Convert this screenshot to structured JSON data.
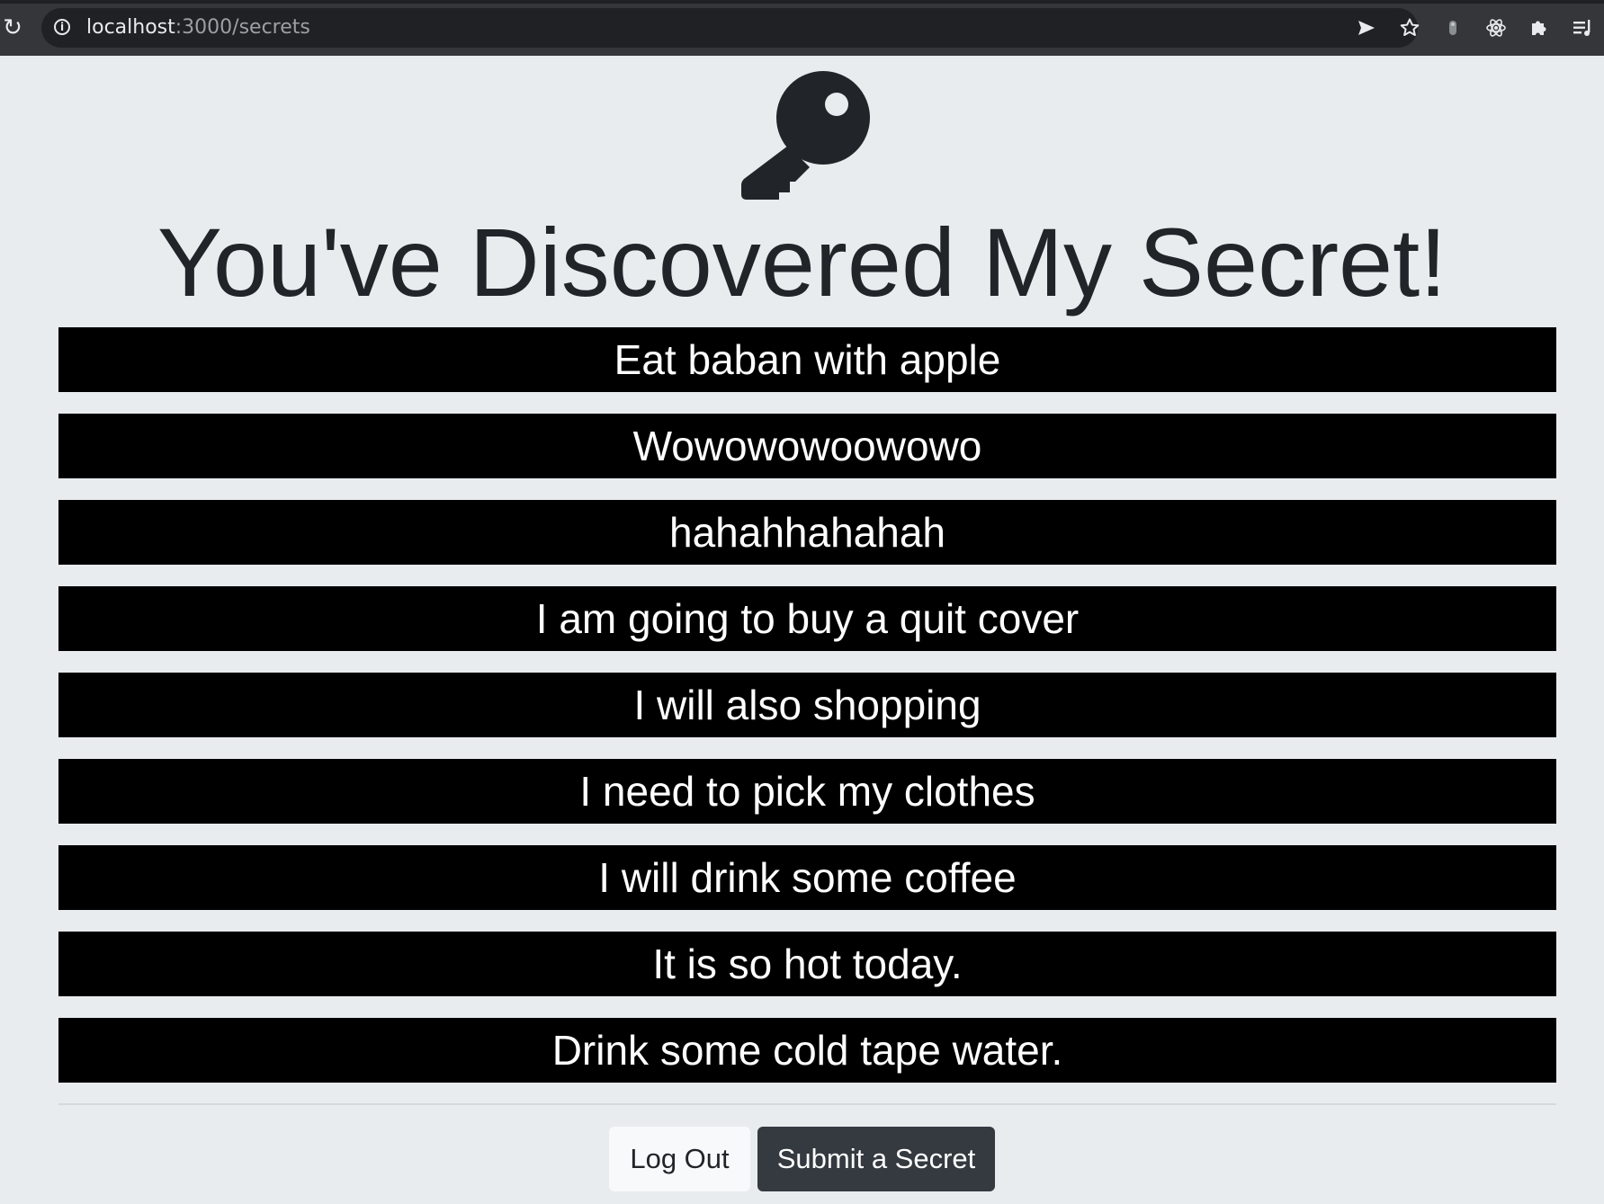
{
  "browser": {
    "url_host": "localhost",
    "url_path": ":3000/secrets",
    "icons": [
      "reload-icon",
      "site-info-icon",
      "send-icon",
      "bookmark-star-icon",
      "profile-icon",
      "react-devtools-icon",
      "extensions-icon",
      "reading-list-icon"
    ]
  },
  "header": {
    "icon": "key-icon",
    "title": "You've Discovered My Secret!"
  },
  "secrets": [
    "Eat baban with apple",
    "Wowowowoowowo",
    "hahahhahahah",
    "I am going to buy a quit cover",
    "I will also shopping",
    "I need to pick my clothes",
    "I will drink some coffee",
    "It is so hot today.",
    "Drink some cold tape water."
  ],
  "actions": {
    "logout_label": "Log Out",
    "submit_label": "Submit a Secret"
  },
  "colors": {
    "page_background": "#e9ecef",
    "secret_background": "#000000",
    "secret_text": "#ffffff",
    "dark_button": "#343a40",
    "light_button": "#f8f9fa"
  }
}
